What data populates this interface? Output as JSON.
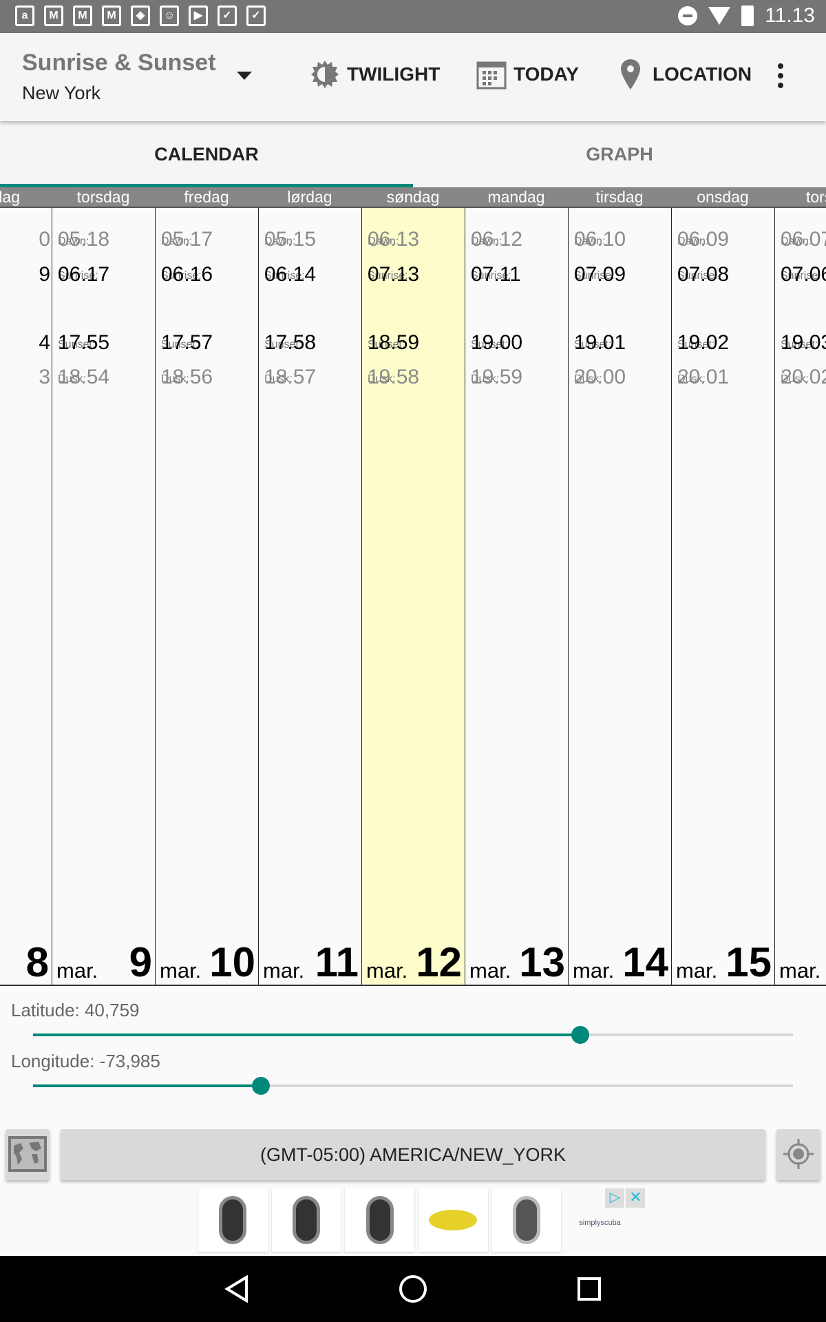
{
  "status_bar": {
    "time": "11.13",
    "notification_icons": [
      "amazon-icon",
      "gmail-icon",
      "gmail-icon",
      "gmail-icon",
      "vpn-shield-icon",
      "android-icon",
      "play-store-icon",
      "task-icon",
      "task-icon"
    ],
    "status_icons": [
      "do-not-disturb-icon",
      "wifi-icon",
      "battery-charging-icon"
    ]
  },
  "app_bar": {
    "title": "Sunrise & Sunset",
    "subtitle": "New York",
    "actions": [
      {
        "label": "TWILIGHT",
        "icon": "twilight-sun-icon"
      },
      {
        "label": "TODAY",
        "icon": "calendar-icon"
      },
      {
        "label": "LOCATION",
        "icon": "location-pin-icon"
      }
    ]
  },
  "tabs": [
    {
      "label": "CALENDAR",
      "active": true
    },
    {
      "label": "GRAPH",
      "active": false
    }
  ],
  "labels": {
    "dawn": "Dawn:",
    "sunrise": "Sunrise:",
    "sunset": "Sunset:",
    "dusk": "Dusk:"
  },
  "calendar": [
    {
      "weekday": "dag",
      "dawn": "0",
      "sunrise": "9",
      "sunset": "4",
      "dusk": "3",
      "month": "",
      "day": "8",
      "partial": "left"
    },
    {
      "weekday": "torsdag",
      "dawn": "05.18",
      "sunrise": "06.17",
      "sunset": "17.55",
      "dusk": "18.54",
      "month": "mar.",
      "day": "9"
    },
    {
      "weekday": "fredag",
      "dawn": "05.17",
      "sunrise": "06.16",
      "sunset": "17.57",
      "dusk": "18.56",
      "month": "mar.",
      "day": "10"
    },
    {
      "weekday": "lørdag",
      "dawn": "05.15",
      "sunrise": "06.14",
      "sunset": "17.58",
      "dusk": "18.57",
      "month": "mar.",
      "day": "11"
    },
    {
      "weekday": "søndag",
      "dawn": "06.13",
      "sunrise": "07.13",
      "sunset": "18.59",
      "dusk": "19.58",
      "month": "mar.",
      "day": "12",
      "today": true
    },
    {
      "weekday": "mandag",
      "dawn": "06.12",
      "sunrise": "07.11",
      "sunset": "19.00",
      "dusk": "19.59",
      "month": "mar.",
      "day": "13"
    },
    {
      "weekday": "tirsdag",
      "dawn": "06.10",
      "sunrise": "07.09",
      "sunset": "19.01",
      "dusk": "20.00",
      "month": "mar.",
      "day": "14"
    },
    {
      "weekday": "onsdag",
      "dawn": "06.09",
      "sunrise": "07.08",
      "sunset": "19.02",
      "dusk": "20.01",
      "month": "mar.",
      "day": "15"
    },
    {
      "weekday": "tors",
      "dawn": "06.07",
      "sunrise": "07.06",
      "sunset": "19.03",
      "dusk": "20.02",
      "month": "mar.",
      "day": "",
      "partial": "right"
    }
  ],
  "latitude": {
    "label": "Latitude: 40,759",
    "fraction": 0.72
  },
  "longitude": {
    "label": "Longitude: -73,985",
    "fraction": 0.3
  },
  "timezone_button": "(GMT-05:00) AMERICA/NEW_YORK",
  "ad": {
    "brand": "simplyscuba"
  },
  "colors": {
    "accent": "#00897b",
    "today": "#fdfdcc",
    "status_bar": "#757575"
  }
}
